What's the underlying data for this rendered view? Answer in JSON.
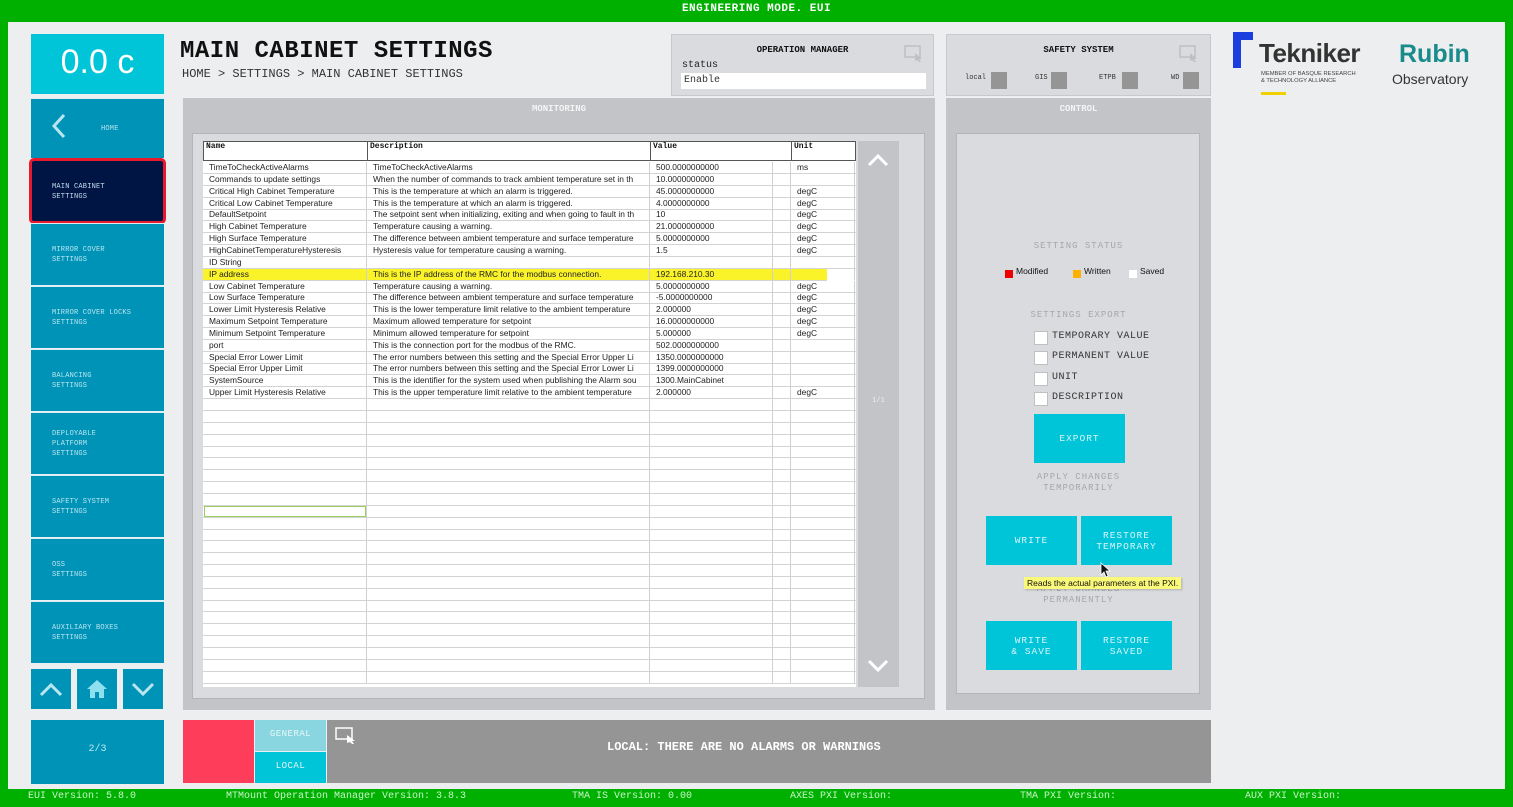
{
  "topbar": {
    "title": "ENGINEERING MODE. EUI"
  },
  "temperature": {
    "value": "0.0 c"
  },
  "sidebar": {
    "home": {
      "label": "HOME"
    },
    "items": [
      {
        "label": "MAIN CABINET\nSETTINGS",
        "active": true
      },
      {
        "label": "MIRROR COVER\nSETTINGS"
      },
      {
        "label": "MIRROR COVER LOCKS\nSETTINGS"
      },
      {
        "label": "BALANCING\nSETTINGS"
      },
      {
        "label": "DEPLOYABLE\nPLATFORM\nSETTINGS"
      },
      {
        "label": "SAFETY SYSTEM\nSETTINGS"
      },
      {
        "label": "OSS\nSETTINGS"
      },
      {
        "label": "AUXILIARY BOXES\nSETTINGS"
      }
    ],
    "page": "2/3"
  },
  "header": {
    "title": "MAIN CABINET SETTINGS",
    "breadcrumb": "HOME > SETTINGS > MAIN CABINET SETTINGS"
  },
  "operation_manager": {
    "title": "OPERATION MANAGER",
    "status_label": "status",
    "status_value": "Enable"
  },
  "safety_system": {
    "title": "SAFETY SYSTEM",
    "indicators": [
      {
        "label": "local",
        "color": "#959595"
      },
      {
        "label": "GIS",
        "color": "#959595"
      },
      {
        "label": "ETPB",
        "color": "#959595"
      },
      {
        "label": "WD",
        "color": "#959595"
      }
    ]
  },
  "logos": {
    "tekniker": "Tekniker",
    "tekniker_sub1": "MEMBER OF BASQUE RESEARCH",
    "tekniker_sub2": "& TECHNOLOGY ALLIANCE",
    "rubin": "Rubin",
    "rubin_sub": "Observatory"
  },
  "monitoring": {
    "title": "MONITORING",
    "columns": [
      "Name",
      "Description",
      "Value",
      "Unit"
    ],
    "rows": [
      {
        "name": "TimeToCheckActiveAlarms",
        "description": "TimeToCheckActiveAlarms",
        "value": "500.0000000000",
        "unit": "ms"
      },
      {
        "name": "Commands to update settings",
        "description": "When the number of commands to track ambient temperature set in th",
        "value": "10.0000000000",
        "unit": ""
      },
      {
        "name": "Critical High Cabinet Temperature",
        "description": "This is the temperature at which an alarm is triggered.",
        "value": "45.0000000000",
        "unit": "degC"
      },
      {
        "name": "Critical Low Cabinet Temperature",
        "description": "This is the temperature at which an alarm is triggered.",
        "value": "4.0000000000",
        "unit": "degC"
      },
      {
        "name": "DefaultSetpoint",
        "description": "The setpoint sent when initializing, exiting and when going to fault in th",
        "value": "10",
        "unit": "degC"
      },
      {
        "name": "High Cabinet Temperature",
        "description": "Temperature causing a warning.",
        "value": "21.0000000000",
        "unit": "degC"
      },
      {
        "name": "High Surface Temperature",
        "description": "The difference between ambient temperature and surface temperature",
        "value": "5.0000000000",
        "unit": "degC"
      },
      {
        "name": "HighCabinetTemperatureHysteresis",
        "description": "Hysteresis value for temperature causing a warning.",
        "value": "1.5",
        "unit": "degC"
      },
      {
        "name": "ID String",
        "description": "",
        "value": "",
        "unit": ""
      },
      {
        "name": "IP address",
        "description": "This is the IP address of the RMC for the modbus connection.",
        "value": "192.168.210.30",
        "unit": "",
        "highlighted": true
      },
      {
        "name": "Low Cabinet Temperature",
        "description": "Temperature causing a warning.",
        "value": "5.0000000000",
        "unit": "degC"
      },
      {
        "name": "Low Surface Temperature",
        "description": "The difference between ambient temperature and surface temperature",
        "value": "-5.0000000000",
        "unit": "degC"
      },
      {
        "name": "Lower Limit Hysteresis Relative",
        "description": "This is the lower temperature limit  relative to the ambient temperature",
        "value": "2.000000",
        "unit": "degC"
      },
      {
        "name": "Maximum Setpoint Temperature",
        "description": "Maximum allowed temperature for setpoint",
        "value": "16.0000000000",
        "unit": "degC"
      },
      {
        "name": "Minimum Setpoint Temperature",
        "description": "Minimum allowed temperature for setpoint",
        "value": "5.000000",
        "unit": "degC"
      },
      {
        "name": "port",
        "description": "This is the connection port for the modbus of the RMC.",
        "value": "502.0000000000",
        "unit": ""
      },
      {
        "name": "Special Error Lower Limit",
        "description": "The error numbers between this setting and the Special Error Upper Li",
        "value": "1350.0000000000",
        "unit": ""
      },
      {
        "name": "Special Error Upper Limit",
        "description": "The error numbers between this setting and the Special Error Lower Li",
        "value": "1399.0000000000",
        "unit": ""
      },
      {
        "name": "SystemSource",
        "description": "This is the identifier for the system used when publishing the Alarm sou",
        "value": "1300.MainCabinet",
        "unit": ""
      },
      {
        "name": "Upper Limit Hysteresis Relative",
        "description": "This is the upper temperature limit  relative to the ambient temperature",
        "value": "2.000000",
        "unit": "degC"
      }
    ],
    "page": "1/1"
  },
  "control": {
    "title": "CONTROL",
    "setting_status_title": "SETTING STATUS",
    "legend": [
      {
        "label": "Modified",
        "color": "#ee0000"
      },
      {
        "label": "Written",
        "color": "#ffb000"
      },
      {
        "label": "Saved",
        "color": "#ffffff"
      }
    ],
    "export_title": "SETTINGS EXPORT",
    "export_options": [
      {
        "label": "TEMPORARY VALUE",
        "checked": false
      },
      {
        "label": "PERMANENT VALUE",
        "checked": false
      },
      {
        "label": "UNIT",
        "checked": false
      },
      {
        "label": "DESCRIPTION",
        "checked": false
      }
    ],
    "export_button": "EXPORT",
    "apply_temp_title": "APPLY CHANGES\nTEMPORARILY",
    "write_button": "WRITE",
    "restore_temp_button": "RESTORE\nTEMPORARY",
    "apply_perm_title": "APPLY CHANGES\nPERMANENTLY",
    "write_save_button": "WRITE\n& SAVE",
    "restore_saved_button": "RESTORE\nSAVED",
    "tooltip": "Reads the actual parameters at the PXI."
  },
  "alarms": {
    "tab_general": "GENERAL",
    "tab_local": "LOCAL",
    "message": "LOCAL: THERE ARE NO ALARMS OR WARNINGS"
  },
  "footer": {
    "eui_version": "EUI Version: 5.8.0",
    "om_version": "MTMount Operation Manager Version: 3.8.3",
    "tma_is_version": "TMA IS Version: 0.00",
    "axes_pxi_version": "AXES PXI Version:",
    "tma_pxi_version": "TMA PXI Version:",
    "aux_pxi_version": "AUX PXI Version:"
  }
}
